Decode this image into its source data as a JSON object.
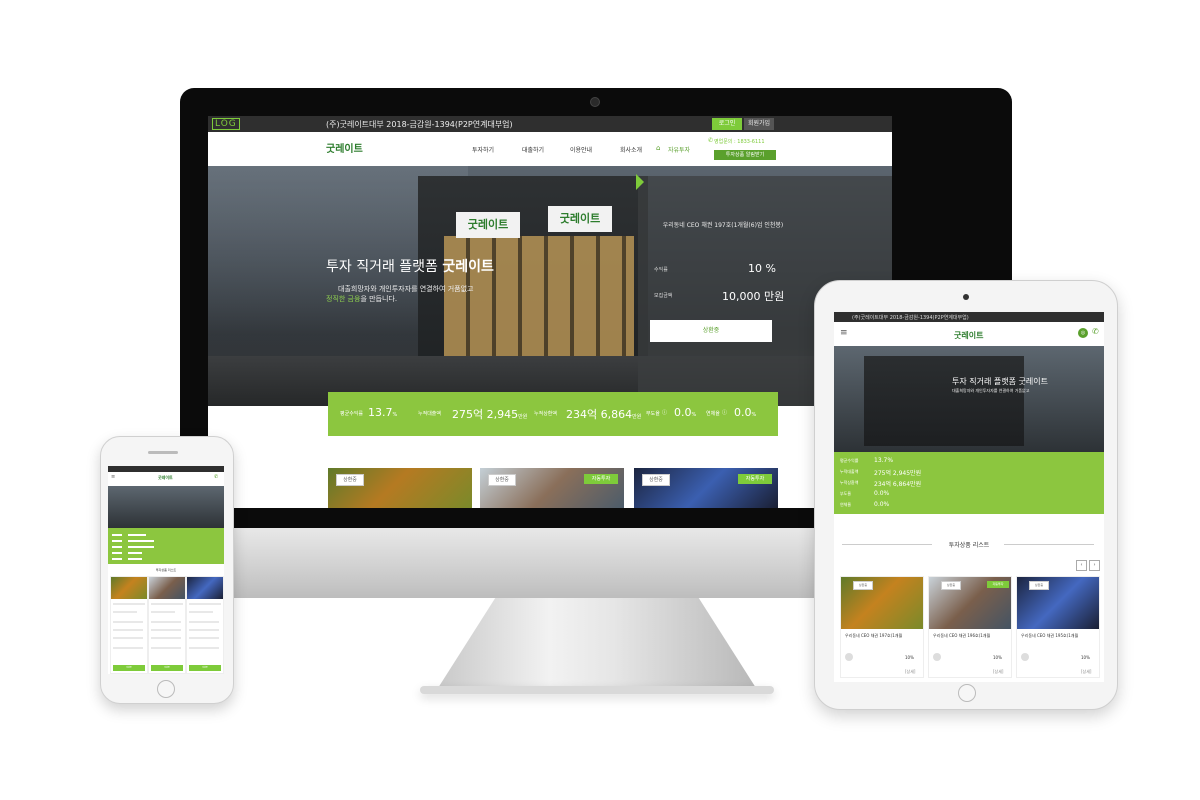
{
  "desktop": {
    "logo_mark": "LOG",
    "company": "(주)굿레이트대부 2018-금감원-1394(P2P연계대부업)",
    "login": "로그인",
    "signup": "회원가입",
    "brand": "굿레이트",
    "nav": [
      "투자하기",
      "대출하기",
      "이용안내",
      "회사소개",
      "자유투자"
    ],
    "phone": "영업문의 : 1833-6111",
    "list_button": "투자상품 알림받기",
    "hero_title_normal": "투자 직거래 플랫폼",
    "hero_title_bold": "굿레이트",
    "hero_sub1": "대출희망자와 개인투자자를 연결하여 거품없고",
    "hero_sub2_highlight": "정직한 금융",
    "hero_sub2_rest": "을 만듭니다.",
    "sign_text": "굿레이트",
    "panel": {
      "title": "우리동네 CEO 채권 197호(1개월(6)업 인천봉)",
      "rate_label": "수익률",
      "rate_value": "10",
      "rate_unit": "%",
      "amount_label": "모집금액",
      "amount_value": "10,000",
      "amount_unit": "만원",
      "button": "상환중"
    },
    "stats": [
      {
        "label": "평균수익률",
        "value": "13.7",
        "unit": "%"
      },
      {
        "label": "누적대출액",
        "value": "275억 2,945",
        "unit": "만원"
      },
      {
        "label": "누적상환액",
        "value": "234억 6,864",
        "unit": "만원"
      },
      {
        "label": "부도율",
        "value": "0.0",
        "unit": "%"
      },
      {
        "label": "연체율",
        "value": "0.0",
        "unit": "%"
      }
    ],
    "thumbs": [
      {
        "tag": "상환중",
        "tag2": ""
      },
      {
        "tag": "상환중",
        "tag2": "자동투자"
      },
      {
        "tag": "상환중",
        "tag2": "자동투자"
      }
    ]
  },
  "tablet": {
    "top": "(주)굿레이트대부 2018-금감원-1394(P2P연계대부업)",
    "brand": "굿레이트",
    "hero_text": "투자 직거래 플랫폼 굿레이트",
    "hero_sub": "대출희망자와 개인투자자를 연결하여 거품없고",
    "stats": [
      {
        "label": "평균수익률",
        "value": "13.7%"
      },
      {
        "label": "누적대출액",
        "value": "275억 2,945만원"
      },
      {
        "label": "누적상환액",
        "value": "234억 6,864만원"
      },
      {
        "label": "부도율",
        "value": "0.0%"
      },
      {
        "label": "연체율",
        "value": "0.0%"
      }
    ],
    "list_title": "투자상품 리스트",
    "prev": "‹",
    "next": "›",
    "cards": [
      {
        "tag": "상환중",
        "tag2": "",
        "name": "우리동네 CEO 채권 197호(1개월",
        "rate": "10%",
        "more": "[상세]"
      },
      {
        "tag": "상환중",
        "tag2": "자동투자",
        "name": "우리동네 CEO 채권 196호(1개월",
        "rate": "10%",
        "more": "[상세]"
      },
      {
        "tag": "상환중",
        "tag2": "",
        "name": "우리동네 CEO 채권 195호(1개월",
        "rate": "10%",
        "more": "[상세]"
      }
    ]
  },
  "phone": {
    "brand": "굿레이트",
    "list_title": "투자상품 리스트",
    "button": "상환중"
  },
  "colors": {
    "accent": "#8cc63f",
    "accent_dark": "#5aa02c",
    "brand_text": "#2d7d2d",
    "topbar": "#2f2f2f"
  }
}
